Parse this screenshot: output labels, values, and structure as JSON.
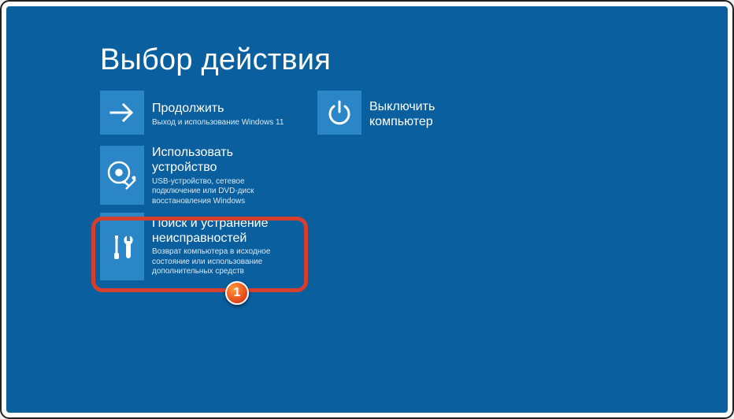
{
  "title": "Выбор действия",
  "tiles": {
    "continue": {
      "label": "Продолжить",
      "desc": "Выход и использование Windows 11"
    },
    "shutdown": {
      "label": "Выключить компьютер"
    },
    "usedevice": {
      "label": "Использовать устройство",
      "desc": "USB-устройство, сетевое подключение или DVD-диск восстановления Windows"
    },
    "troubleshoot": {
      "label": "Поиск и устранение неисправностей",
      "desc": "Возврат компьютера в исходное состояние или использование дополнительных средств"
    }
  },
  "annotation": {
    "badge": "1"
  },
  "colors": {
    "bg": "#0a5f9e",
    "tile": "#2a86c7",
    "highlight": "#d63f2e"
  }
}
